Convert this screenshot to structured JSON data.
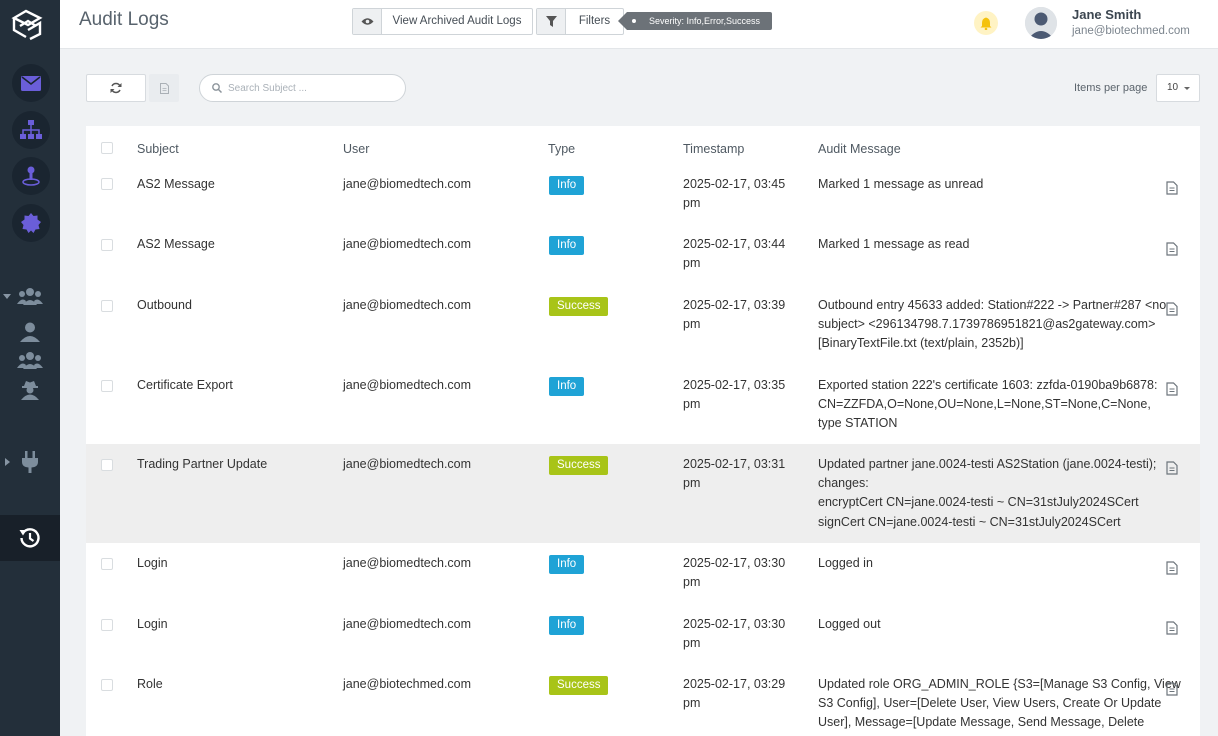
{
  "header": {
    "title": "Audit Logs",
    "archived_label": "View Archived Audit Logs",
    "filters_label": "Filters",
    "filter_tag": "Severity: Info,Error,Success"
  },
  "user": {
    "name": "Jane Smith",
    "email": "jane@biotechmed.com"
  },
  "toolbar": {
    "search_placeholder": "Search Subject ...",
    "items_per_page_label": "Items per page",
    "items_per_page_value": "10"
  },
  "table": {
    "columns": [
      "Subject",
      "User",
      "Type",
      "Timestamp",
      "Audit Message"
    ],
    "rows": [
      {
        "subject": "AS2 Message",
        "user": "jane@biomedtech.com",
        "type": "Info",
        "ts1": "2025-02-17, 03:45",
        "ts2": "pm",
        "msg": [
          "Marked 1 message as unread"
        ]
      },
      {
        "subject": "AS2 Message",
        "user": "jane@biomedtech.com",
        "type": "Info",
        "ts1": "2025-02-17, 03:44",
        "ts2": "pm",
        "msg": [
          "Marked 1 message as read"
        ]
      },
      {
        "subject": "Outbound",
        "user": "jane@biomedtech.com",
        "type": "Success",
        "ts1": "2025-02-17, 03:39",
        "ts2": "pm",
        "msg": [
          "Outbound entry 45633 added: Station#222 -> Partner#287 <no",
          "subject> <296134798.7.1739786951821@as2gateway.com>",
          "[BinaryTextFile.txt (text/plain, 2352b)]"
        ]
      },
      {
        "subject": "Certificate Export",
        "user": "jane@biomedtech.com",
        "type": "Info",
        "ts1": "2025-02-17, 03:35",
        "ts2": "pm",
        "msg": [
          "Exported station 222's certificate 1603: zzfda-0190ba9b6878:",
          "CN=ZZFDA,O=None,OU=None,L=None,ST=None,C=None,",
          "type STATION"
        ]
      },
      {
        "subject": "Trading Partner Update",
        "user": "jane@biomedtech.com",
        "type": "Success",
        "ts1": "2025-02-17, 03:31",
        "ts2": "pm",
        "msg": [
          "Updated partner jane.0024-testi AS2Station (jane.0024-testi);",
          "changes:",
          "encryptCert CN=jane.0024-testi ~ CN=31stJuly2024SCert",
          "signCert CN=jane.0024-testi ~ CN=31stJuly2024SCert"
        ]
      },
      {
        "subject": "Login",
        "user": "jane@biomedtech.com",
        "type": "Info",
        "ts1": "2025-02-17, 03:30",
        "ts2": "pm",
        "msg": [
          "Logged in"
        ]
      },
      {
        "subject": "Login",
        "user": "jane@biomedtech.com",
        "type": "Info",
        "ts1": "2025-02-17, 03:30",
        "ts2": "pm",
        "msg": [
          "Logged out"
        ]
      },
      {
        "subject": "Role",
        "user": "jane@biotechmed.com",
        "type": "Success",
        "ts1": "2025-02-17, 03:29",
        "ts2": "pm",
        "msg": [
          "Updated role ORG_ADMIN_ROLE {S3=[Manage S3 Config, View",
          "S3 Config], User=[Delete User, View Users, Create Or Update",
          "User], Message=[Update Message, Send Message, Delete"
        ]
      }
    ]
  },
  "colors": {
    "sidebar": "#232f3a",
    "info": "#1fa3d6",
    "success": "#a8c418",
    "highlight": "#eeeeee"
  }
}
